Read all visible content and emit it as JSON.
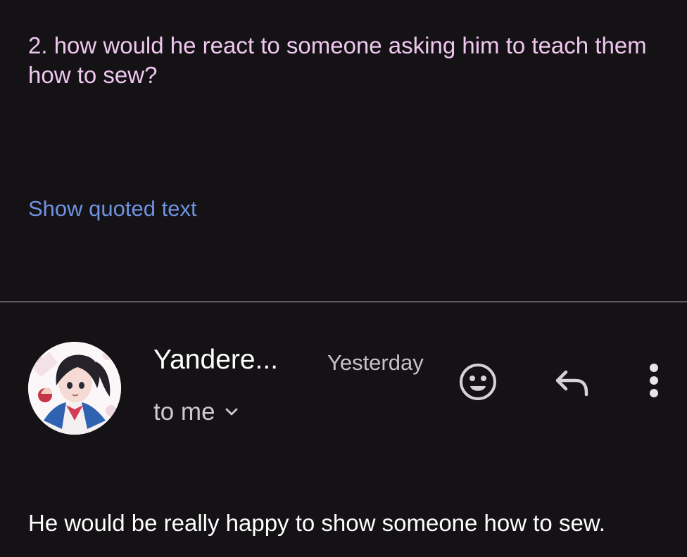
{
  "quoted_message": {
    "question": "2. how would he react to someone asking him to teach them how to sew?",
    "show_quoted_label": "Show quoted text"
  },
  "message": {
    "sender": "Yandere...",
    "timestamp": "Yesterday",
    "recipient": "to me",
    "body": "He would be really happy to show someone how to sew."
  },
  "icons": {
    "emoji": "emoji-icon",
    "reply": "reply-icon",
    "more": "more-vert-icon",
    "expand": "chevron-down-icon"
  },
  "colors": {
    "background": "#151216",
    "quoted_text": "#efc7ef",
    "link": "#6f93df",
    "secondary_text": "#c7c1c8",
    "divider": "#5e5b60"
  }
}
